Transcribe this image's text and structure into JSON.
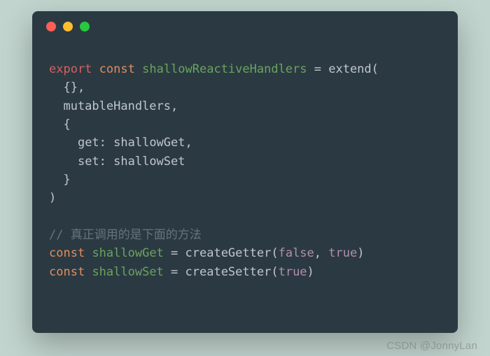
{
  "code": {
    "l1_export": "export",
    "l1_const": "const",
    "l1_ident": "shallowReactiveHandlers",
    "l1_eq": " = ",
    "l1_fn": "extend",
    "l1_open": "(",
    "l2": "  {},",
    "l3": "  mutableHandlers,",
    "l4": "  {",
    "l5_indent": "    ",
    "l5_attr": "get",
    "l5_mid": ": shallowGet,",
    "l6_indent": "    ",
    "l6_attr": "set",
    "l6_mid": ": shallowSet",
    "l7": "  }",
    "l8": ")",
    "blank": "",
    "l10_comment": "// 真正调用的是下面的方法",
    "l11_const": "const",
    "l11_ident": "shallowGet",
    "l11_eq": " = ",
    "l11_fn": "createGetter",
    "l11_open": "(",
    "l11_arg1": "false",
    "l11_sep": ", ",
    "l11_arg2": "true",
    "l11_close": ")",
    "l12_const": "const",
    "l12_ident": "shallowSet",
    "l12_eq": " = ",
    "l12_fn": "createSetter",
    "l12_open": "(",
    "l12_arg1": "true",
    "l12_close": ")"
  },
  "watermark": "CSDN @JonnyLan"
}
